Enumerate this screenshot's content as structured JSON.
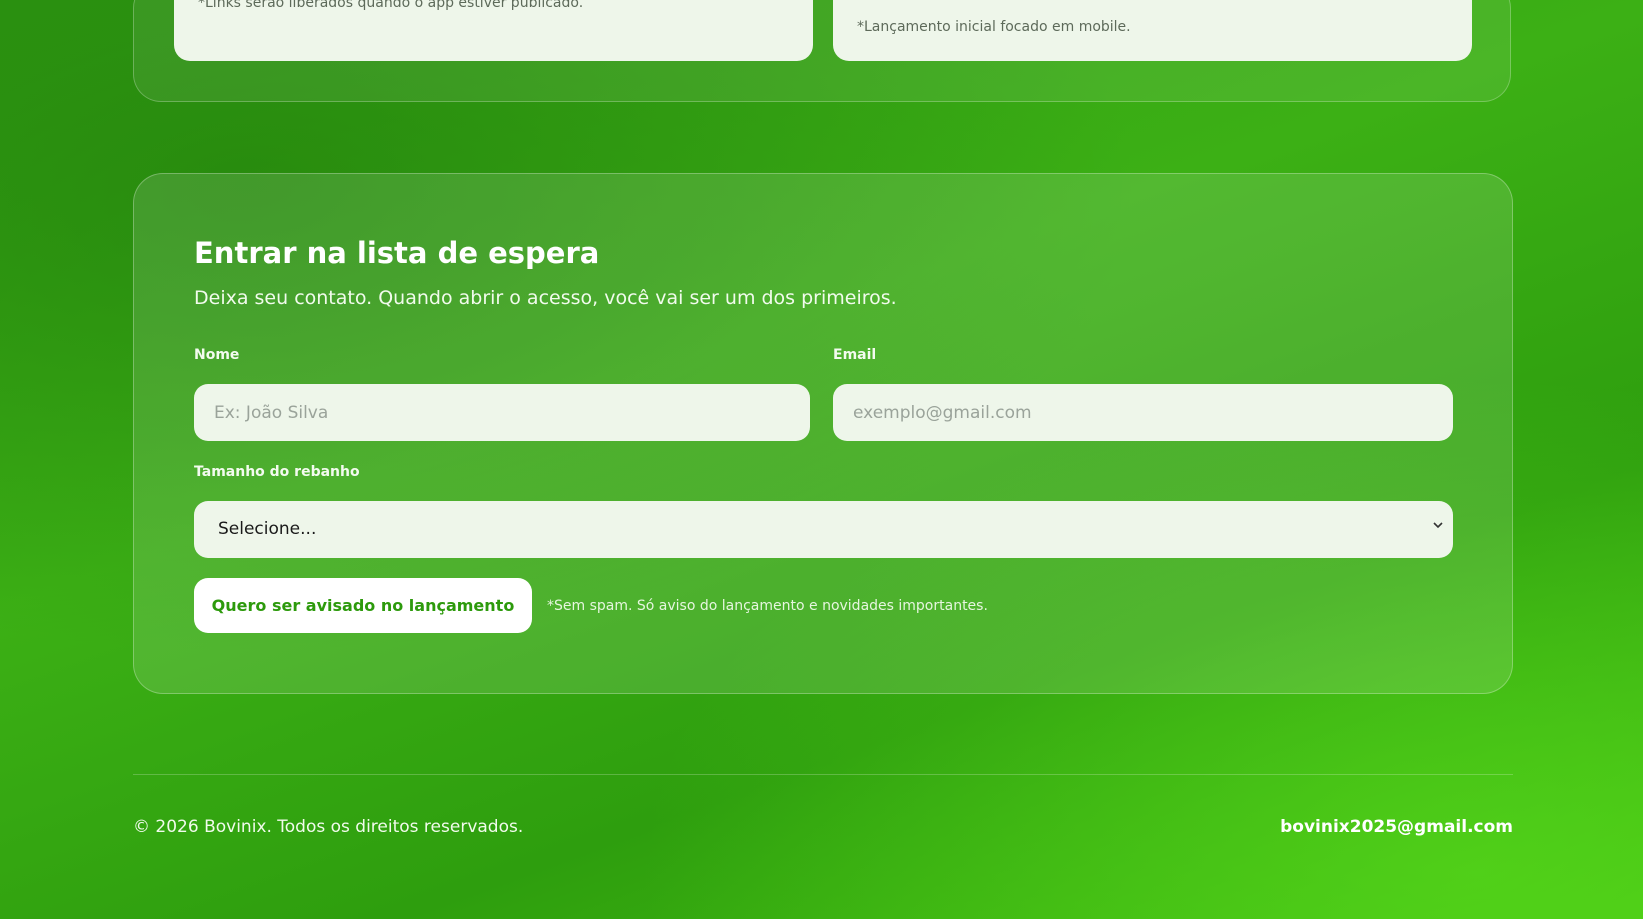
{
  "downloads_section": {
    "left_card_note": "*Links serão liberados quando o app estiver publicado.",
    "right_card_note": "*Lançamento inicial focado em mobile."
  },
  "waitlist": {
    "title": "Entrar na lista de espera",
    "subtitle": "Deixa seu contato. Quando abrir o acesso, você vai ser um dos primeiros.",
    "name_label": "Nome",
    "name_placeholder": "Ex: João Silva",
    "name_value": "",
    "email_label": "Email",
    "email_placeholder": "exemplo@gmail.com",
    "email_value": "",
    "herd_label": "Tamanho do rebanho",
    "herd_selected": "Selecione...",
    "submit_label": "Quero ser avisado no lançamento",
    "spam_note": "*Sem spam. Só aviso do lançamento e novidades importantes."
  },
  "footer": {
    "copyright": "© 2026 Bovinix. Todos os direitos reservados.",
    "email": "bovinix2025@gmail.com"
  },
  "colors": {
    "background_green": "#3cb015",
    "button_text_green": "#2d9a0c",
    "input_background": "#eef6ea"
  },
  "icons": {
    "select_arrow": "chevron-down-icon"
  }
}
